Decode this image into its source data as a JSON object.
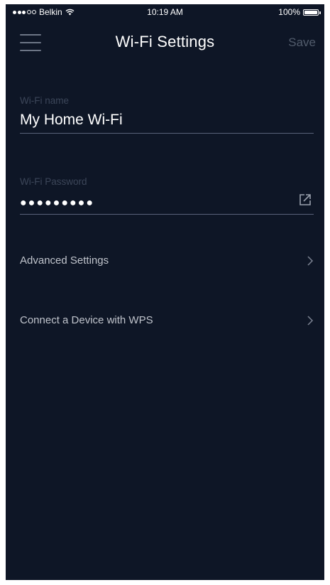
{
  "status_bar": {
    "carrier": "Belkin",
    "time": "10:19 AM",
    "battery": "100%"
  },
  "header": {
    "title": "Wi-Fi Settings",
    "save_label": "Save",
    "menu_icon": "hamburger-icon"
  },
  "form": {
    "wifi_name": {
      "label": "Wi-Fi name",
      "value": "My Home Wi-Fi"
    },
    "wifi_password": {
      "label": "Wi-Fi Password",
      "value": "●●●●●●●●●",
      "action_icon": "external-link-icon"
    }
  },
  "menu": {
    "items": [
      {
        "label": "Advanced Settings",
        "icon": "chevron-right-icon"
      },
      {
        "label": "Connect a Device with WPS",
        "icon": "chevron-right-icon"
      }
    ]
  },
  "colors": {
    "background": "#0e1626",
    "label_dim": "#3c4659",
    "divider": "#59627a",
    "save_disabled": "#525c6c"
  }
}
